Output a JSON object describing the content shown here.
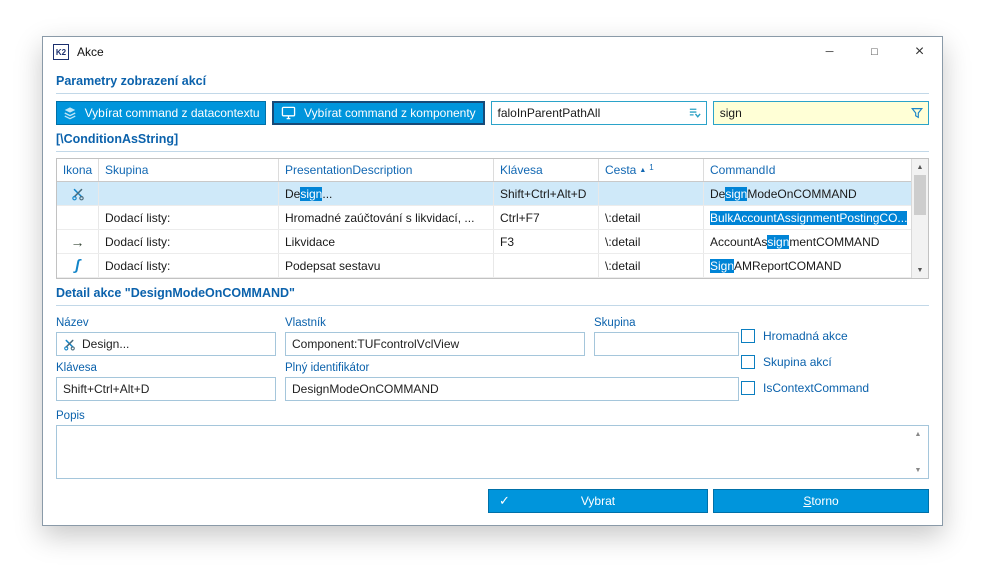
{
  "window": {
    "logo": "K2",
    "title": "Akce",
    "controls": {
      "minimize": "─",
      "maximize": "□",
      "close": "×"
    }
  },
  "sections": {
    "params": "Parametry zobrazení akcí",
    "condition": "[\\ConditionAsString]",
    "detail": "Detail akce \"DesignModeOnCOMMAND\""
  },
  "toolbar": {
    "btn_datacontext": "Vybírat command z datacontextu",
    "btn_component": "Vybírat command z komponenty",
    "combo_value": "faloInParentPathAll",
    "filter_value": "sign"
  },
  "icons": {
    "arrow": "→",
    "signature": "ʃ",
    "check": "✓",
    "scroll_up": "▲",
    "scroll_down": "▼",
    "sort_asc": "▲"
  },
  "table": {
    "columns": [
      "Ikona",
      "Skupina",
      "PresentationDescription",
      "Klávesa",
      "Cesta",
      "CommandId"
    ],
    "sort_order": "1",
    "rows": [
      {
        "skupina": "",
        "pres_pre": "De",
        "pres_hl": "sign",
        "pres_post": "...",
        "klavesa": "Shift+Ctrl+Alt+D",
        "cesta": "",
        "cmd_pre": "De",
        "cmd_hl": "sign",
        "cmd_post": "ModeOnCOMMAND"
      },
      {
        "skupina": "Dodací listy:",
        "pres_pre": "Hromadné zaúčtování s likvidací, ...",
        "pres_hl": "",
        "pres_post": "",
        "klavesa": "Ctrl+F7",
        "cesta": "\\:detail",
        "cmd_pre": "",
        "cmd_hl": "BulkAccountAssignmentPostingCO...",
        "cmd_post": ""
      },
      {
        "skupina": "Dodací listy:",
        "pres_pre": "Likvidace",
        "pres_hl": "",
        "pres_post": "",
        "klavesa": "F3",
        "cesta": "\\:detail",
        "cmd_pre": "AccountAs",
        "cmd_hl": "sign",
        "cmd_post": "mentCOMMAND"
      },
      {
        "skupina": "Dodací listy:",
        "pres_pre": "Podepsat sestavu",
        "pres_hl": "",
        "pres_post": "",
        "klavesa": "",
        "cesta": "\\:detail",
        "cmd_pre": "",
        "cmd_hl": "Sign",
        "cmd_post": "AMReportCOMAND"
      }
    ]
  },
  "detail": {
    "nazev_label": "Název",
    "nazev_value": "Design...",
    "vlastnik_label": "Vlastník",
    "vlastnik_value": "Component:TUFcontrolVclView",
    "skupina_label": "Skupina",
    "skupina_value": "",
    "klavesa_label": "Klávesa",
    "klavesa_value": "Shift+Ctrl+Alt+D",
    "plny_label": "Plný identifikátor",
    "plny_value": "DesignModeOnCOMMAND",
    "popis_label": "Popis",
    "popis_value": "",
    "checkboxes": [
      "Hromadná akce",
      "Skupina akcí",
      "IsContextCommand"
    ]
  },
  "footer": {
    "vybrat": "Vybrat",
    "storno_initial": "S",
    "storno_rest": "torno"
  }
}
